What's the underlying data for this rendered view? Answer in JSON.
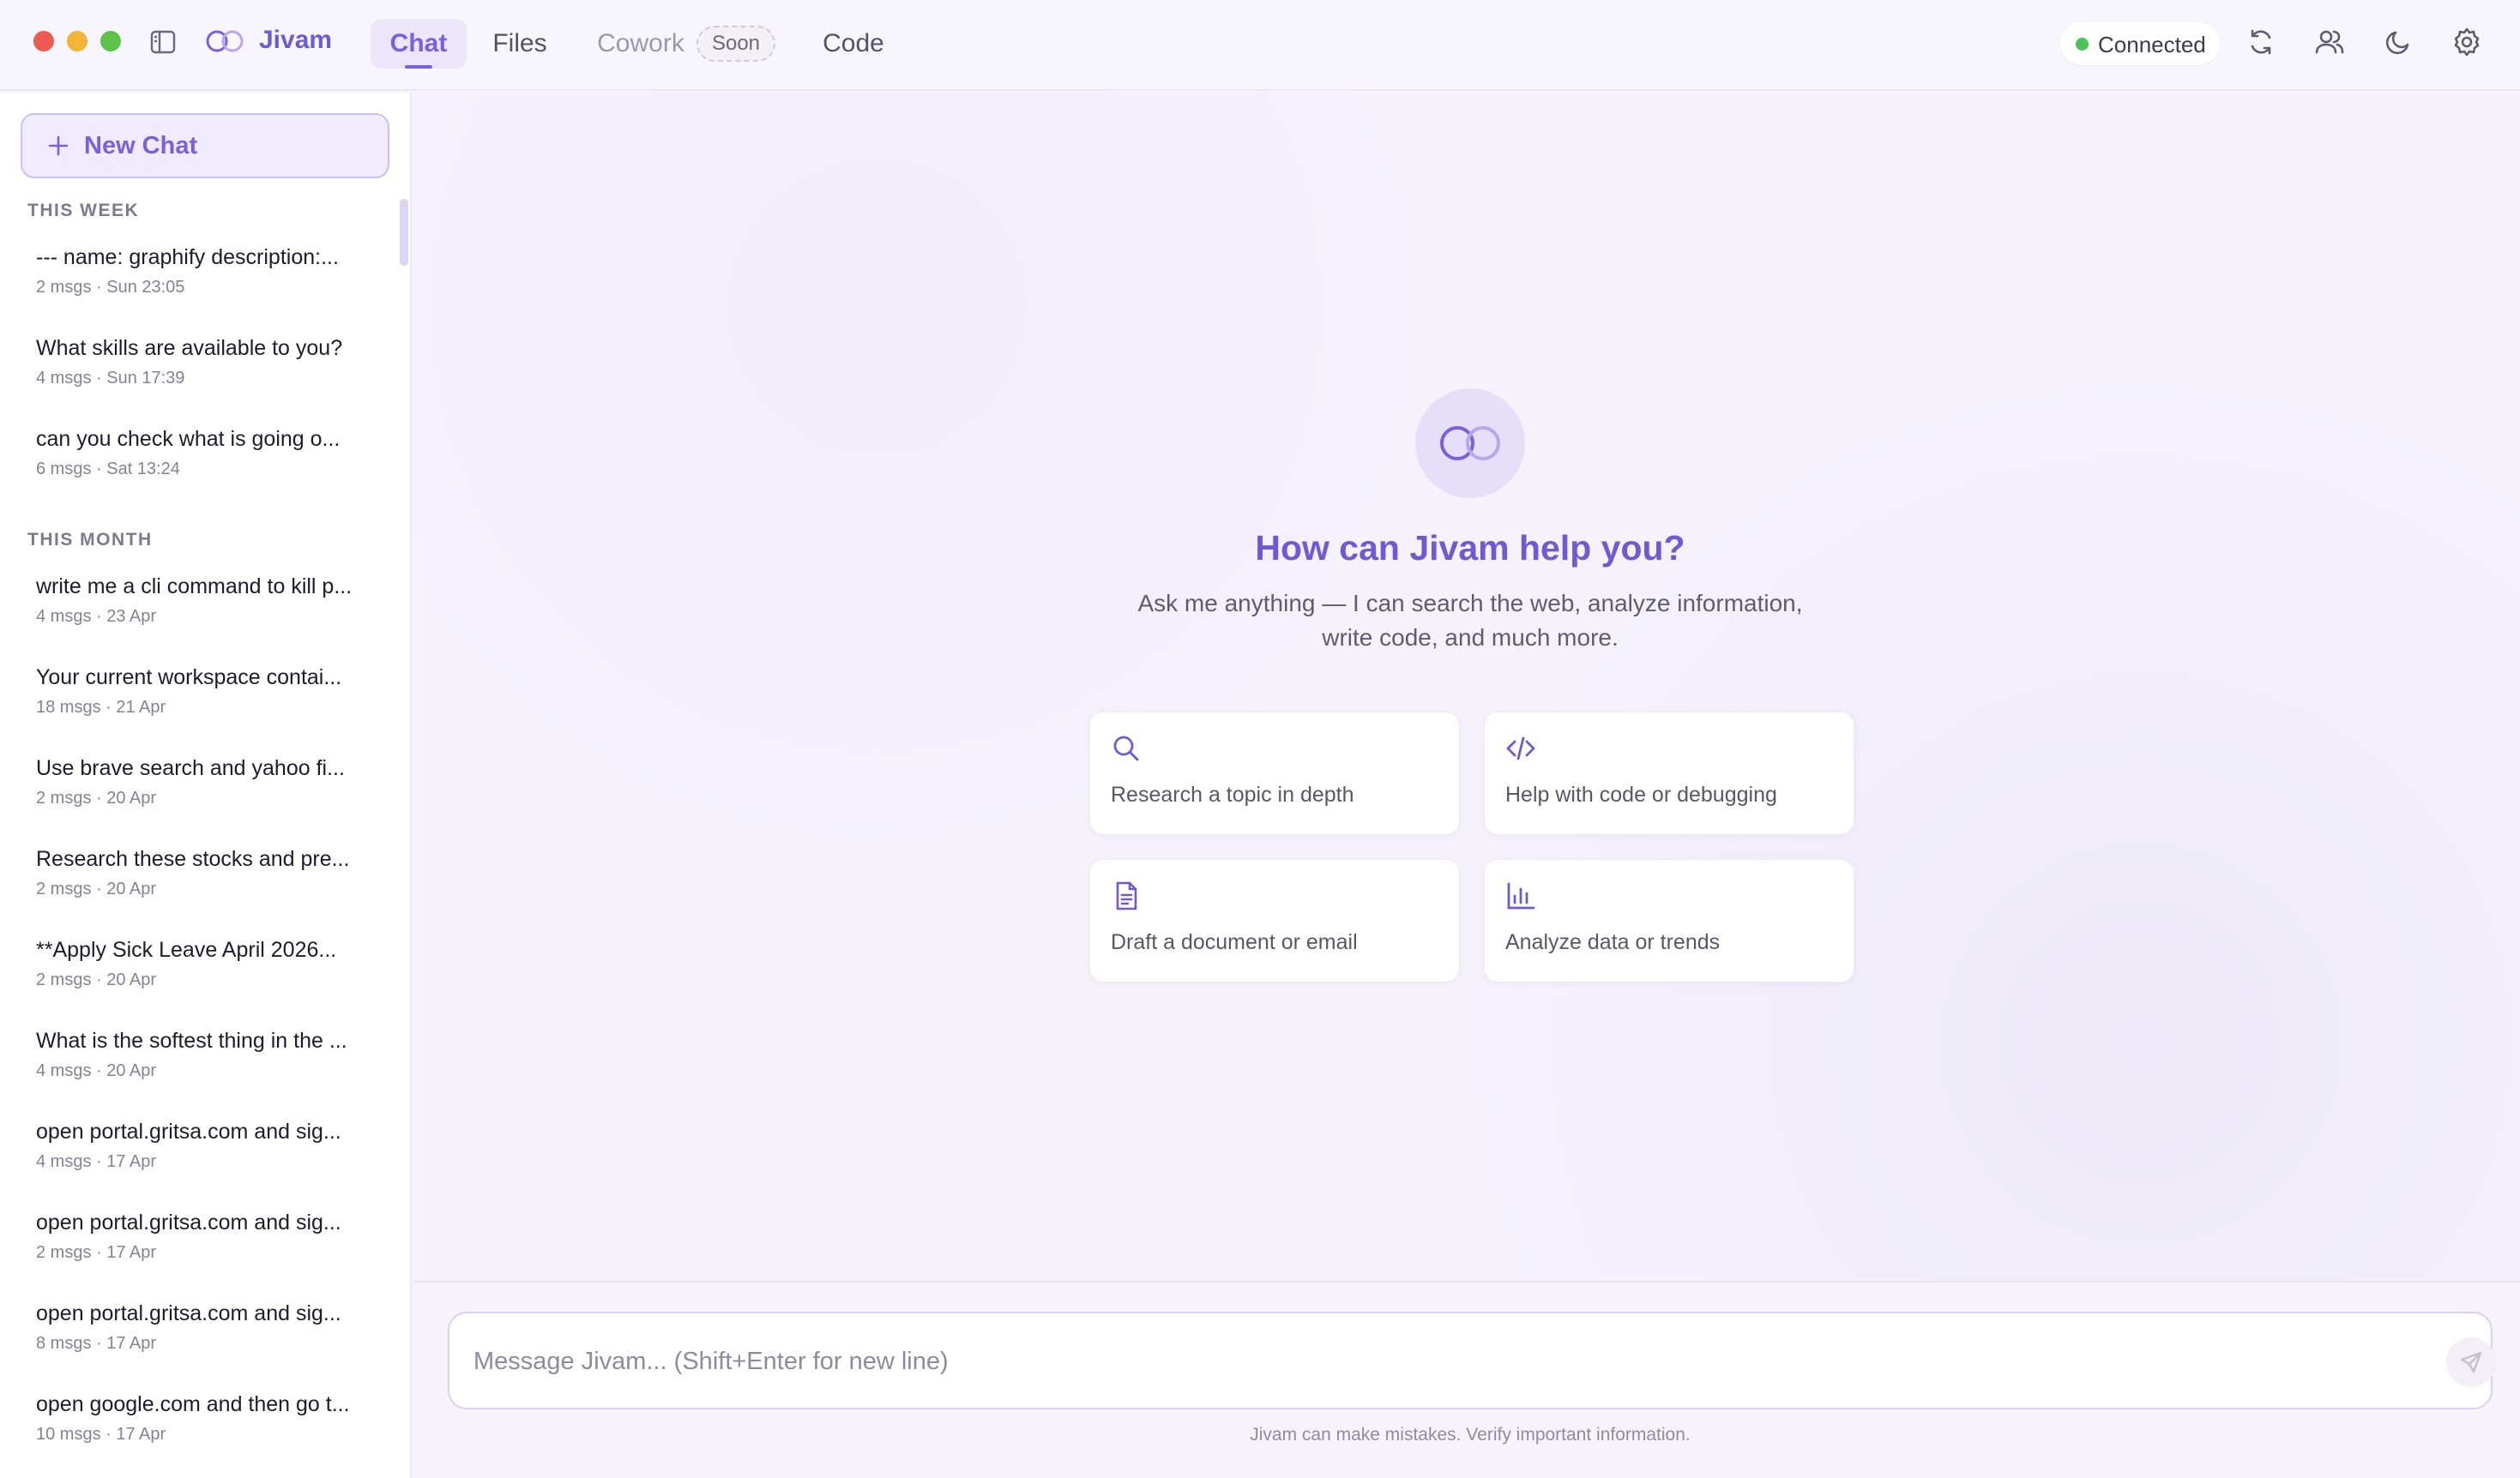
{
  "app": {
    "name": "Jivam",
    "brand_color": "#6f5ad6"
  },
  "nav": {
    "tabs": [
      {
        "label": "Chat",
        "active": true
      },
      {
        "label": "Files",
        "active": false
      },
      {
        "label": "Cowork",
        "active": false,
        "disabled": true
      },
      {
        "label": "Code",
        "active": false
      }
    ],
    "soon_badge": "Soon"
  },
  "status": {
    "label": "Connected",
    "color": "#4cc25a"
  },
  "toolbar_icons": [
    "refresh-icon",
    "users-icon",
    "moon-icon",
    "gear-icon"
  ],
  "sidebar": {
    "new_chat_label": "New Chat",
    "sections": [
      {
        "label": "THIS WEEK",
        "items": [
          {
            "title": "--- name: graphify description:...",
            "meta": "2 msgs · Sun 23:05"
          },
          {
            "title": "What skills are available to you?",
            "meta": "4 msgs · Sun 17:39"
          },
          {
            "title": "can you check what is going o...",
            "meta": "6 msgs · Sat 13:24"
          }
        ]
      },
      {
        "label": "THIS MONTH",
        "items": [
          {
            "title": "write me a cli command to kill p...",
            "meta": "4 msgs · 23 Apr"
          },
          {
            "title": "Your current workspace contai...",
            "meta": "18 msgs · 21 Apr"
          },
          {
            "title": "Use brave search and yahoo fi...",
            "meta": "2 msgs · 20 Apr"
          },
          {
            "title": "Research these stocks and pre...",
            "meta": "2 msgs · 20 Apr"
          },
          {
            "title": "**Apply Sick Leave April 2026...",
            "meta": "2 msgs · 20 Apr"
          },
          {
            "title": "What is the softest thing in the ...",
            "meta": "4 msgs · 20 Apr"
          },
          {
            "title": "open portal.gritsa.com and sig...",
            "meta": "4 msgs · 17 Apr"
          },
          {
            "title": "open portal.gritsa.com and sig...",
            "meta": "2 msgs · 17 Apr"
          },
          {
            "title": "open portal.gritsa.com and sig...",
            "meta": "8 msgs · 17 Apr"
          },
          {
            "title": "open google.com and then go t...",
            "meta": "10 msgs · 17 Apr"
          }
        ]
      }
    ]
  },
  "main": {
    "hero_title": "How can Jivam help you?",
    "hero_subtitle": "Ask me anything — I can search the web, analyze information, write code, and much more.",
    "cards": [
      {
        "icon": "search-icon",
        "label": "Research a topic in depth"
      },
      {
        "icon": "code-icon",
        "label": "Help with code or debugging"
      },
      {
        "icon": "document-icon",
        "label": "Draft a document or email"
      },
      {
        "icon": "bar-chart-icon",
        "label": "Analyze data or trends"
      }
    ]
  },
  "composer": {
    "placeholder": "Message Jivam... (Shift+Enter for new line)",
    "value": "",
    "disclaimer": "Jivam can make mistakes. Verify important information."
  }
}
